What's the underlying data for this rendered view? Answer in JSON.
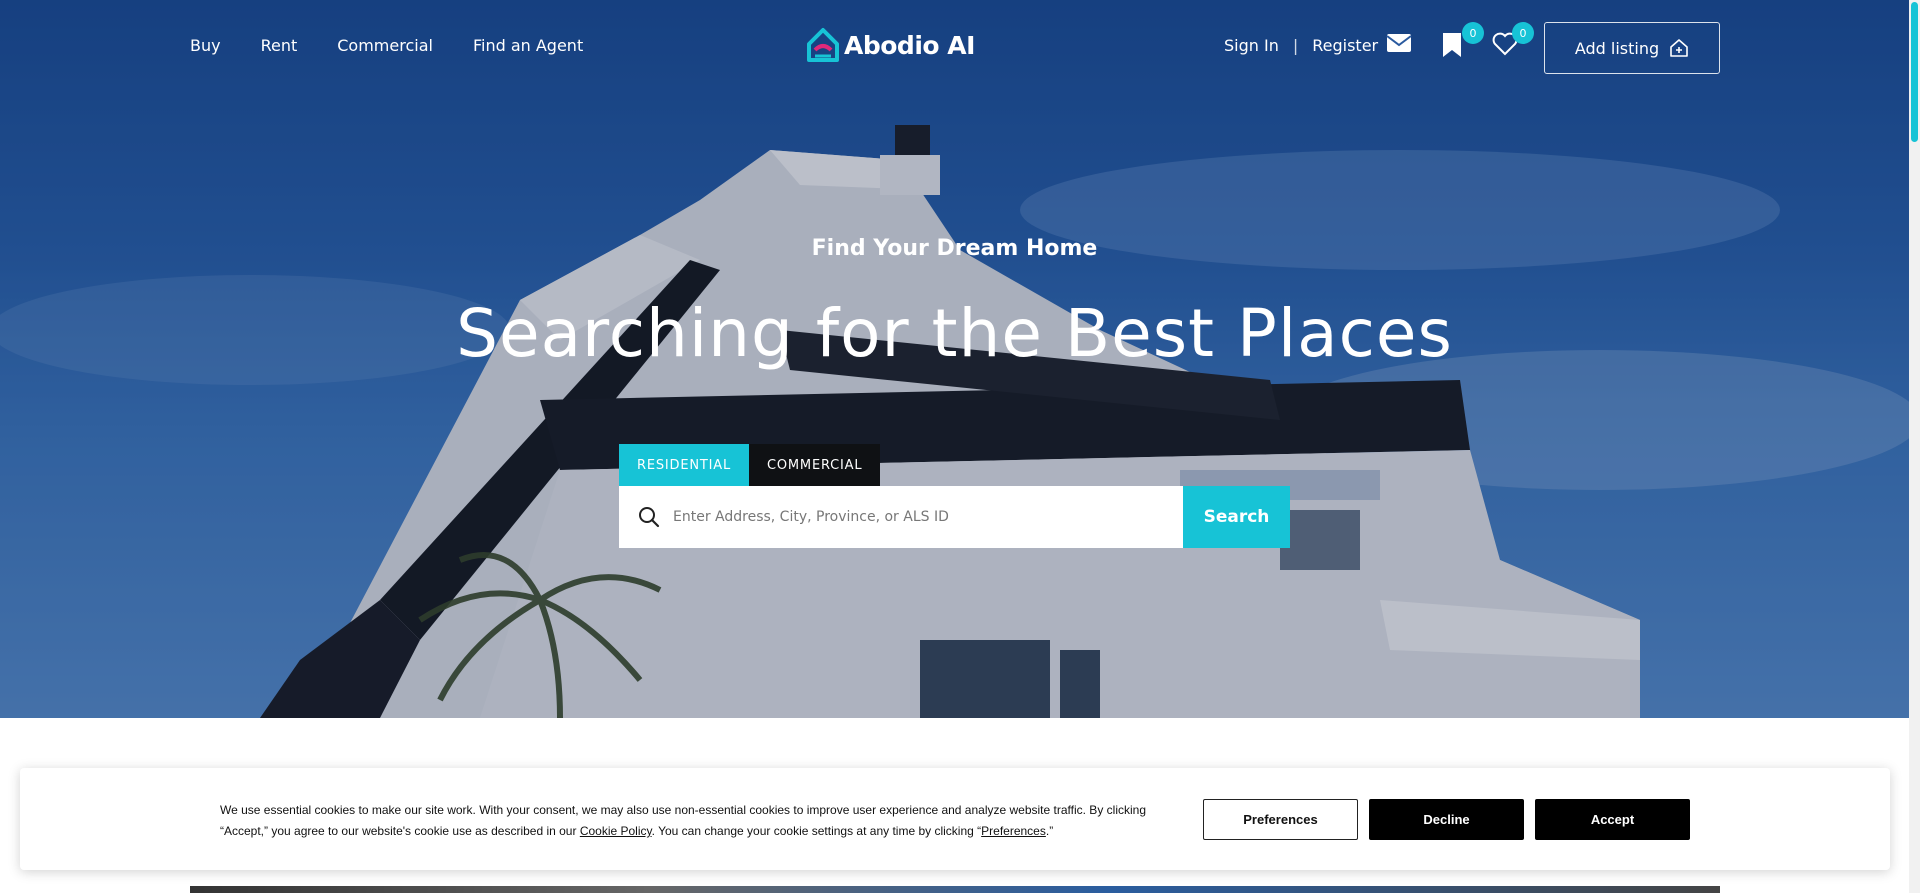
{
  "nav": {
    "links": [
      "Buy",
      "Rent",
      "Commercial",
      "Find an Agent"
    ],
    "logo_text": "Abodio AI",
    "sign_in": "Sign In",
    "separator": "|",
    "register": "Register",
    "saved_count": "0",
    "favorites_count": "0",
    "add_listing": "Add listing"
  },
  "hero": {
    "eyebrow": "Find Your Dream Home",
    "headline": "Searching for the Best Places"
  },
  "search": {
    "tabs": [
      "RESIDENTIAL",
      "COMMERCIAL"
    ],
    "active_tab": "RESIDENTIAL",
    "placeholder": "Enter Address, City, Province, or ALS ID",
    "value": "",
    "button": "Search"
  },
  "cookie": {
    "text_1": "We use essential cookies to make our site work. With your consent, we may also use non-essential cookies to improve user experience and analyze website traffic. By clicking “Accept,” you agree to our website's cookie use as described in our ",
    "cookie_policy": "Cookie Policy",
    "text_2": ". You can change your cookie settings at any time by clicking “",
    "preferences_link": "Preferences",
    "text_3": ".”",
    "preferences_button": "Preferences",
    "decline_button": "Decline",
    "accept_button": "Accept"
  },
  "colors": {
    "accent": "#17c3d6",
    "sky": "#2a64b0",
    "dark_tab": "#0f1114",
    "logo_pink": "#e0287a"
  },
  "icons": [
    "mail-icon",
    "bookmark-icon",
    "heart-icon",
    "house-plus-icon",
    "search-icon",
    "logo-house-icon"
  ]
}
